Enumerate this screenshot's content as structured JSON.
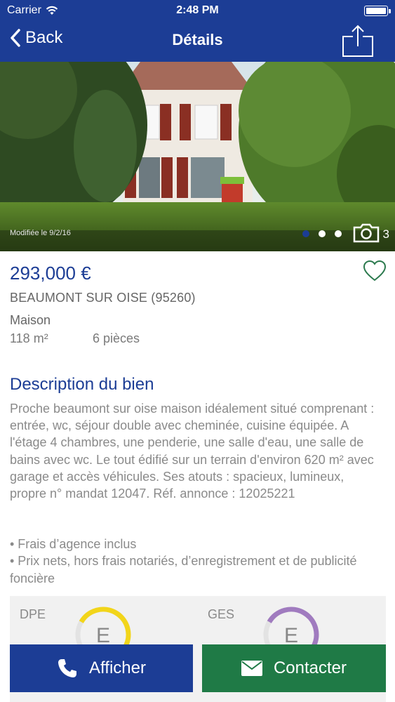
{
  "status": {
    "carrier": "Carrier",
    "time": "2:48 PM"
  },
  "nav": {
    "back_label": "Back",
    "title": "Détails"
  },
  "photo": {
    "modified": "Modifiée le 9/2/16",
    "photo_count": "3",
    "active_index": 0,
    "total_dots": 3
  },
  "listing": {
    "price": "293,000 €",
    "city": "BEAUMONT SUR OISE (95260)",
    "type": "Maison",
    "surface": "118 m²",
    "rooms": "6 pièces"
  },
  "description": {
    "title": "Description du bien",
    "text": "Proche beaumont sur oise maison idéalement situé comprenant : entrée, wc, séjour double avec cheminée, cuisine équipée. A l'étage 4 chambres, une penderie, une salle d'eau, une salle de bains avec wc. Le tout édifié sur un terrain d'environ 620 m² avec garage et accès véhicules. Ses atouts : spacieux, lumineux, propre n° mandat 12047. Réf. annonce : 12025221",
    "bullets": [
      "• Frais d’agence inclus",
      "• Prix nets, hors frais notariés, d’enregistrement et de publicité foncière"
    ]
  },
  "energy": {
    "dpe_label": "DPE",
    "dpe_grade": "E",
    "dpe_color": "#f2d51a",
    "ges_label": "GES",
    "ges_grade": "E",
    "ges_color": "#a07bbf"
  },
  "actions": {
    "call_label": "Afficher",
    "contact_label": "Contacter"
  },
  "colors": {
    "brand_blue": "#1c3d95",
    "contact_green": "#1f7a46"
  }
}
